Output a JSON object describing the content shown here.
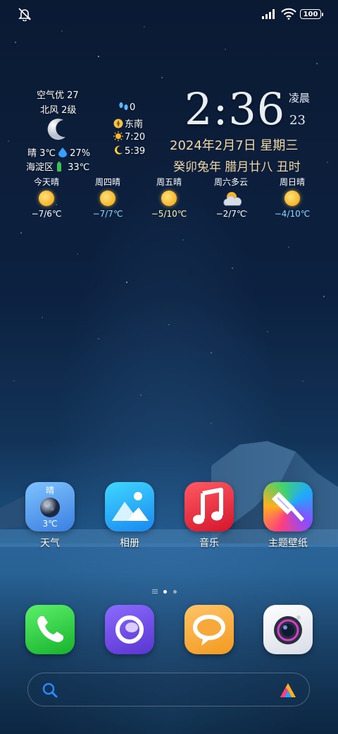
{
  "status_bar": {
    "battery": "100"
  },
  "weather": {
    "aqi": "空气优 27",
    "wind": "北风 2级",
    "condition": "晴 3℃",
    "humidity": "27%",
    "district": "海淀区",
    "device_temp": "33℃",
    "steps": "0",
    "direction": "东南",
    "sunrise": "7:20",
    "moonrise": "5:39"
  },
  "clock": {
    "time": "2:36",
    "period": "凌晨",
    "seconds": "23",
    "date": "2024年2月7日  星期三",
    "lunar": "癸卯兔年  腊月廿八  丑时"
  },
  "forecast": [
    {
      "day": "今天晴",
      "temp": "−7/6℃",
      "icon": "sun",
      "color": "#ffffff"
    },
    {
      "day": "周四晴",
      "temp": "−7/7℃",
      "icon": "sun",
      "color": "#8fd6ff"
    },
    {
      "day": "周五晴",
      "temp": "−5/10℃",
      "icon": "sun",
      "color": "#fff3a6"
    },
    {
      "day": "周六多云",
      "temp": "−2/7℃",
      "icon": "cloudy-sun",
      "color": "#ffffff"
    },
    {
      "day": "周日晴",
      "temp": "−4/10℃",
      "icon": "sun",
      "color": "#8fd6ff"
    }
  ],
  "apps": {
    "weather": {
      "label": "天气",
      "icon_cond": "晴",
      "icon_temp": "3℃"
    },
    "gallery": {
      "label": "相册"
    },
    "music": {
      "label": "音乐"
    },
    "themes": {
      "label": "主题壁纸"
    }
  },
  "dock": [
    "phone",
    "browser",
    "messages",
    "camera"
  ],
  "search": {
    "placeholder": ""
  }
}
